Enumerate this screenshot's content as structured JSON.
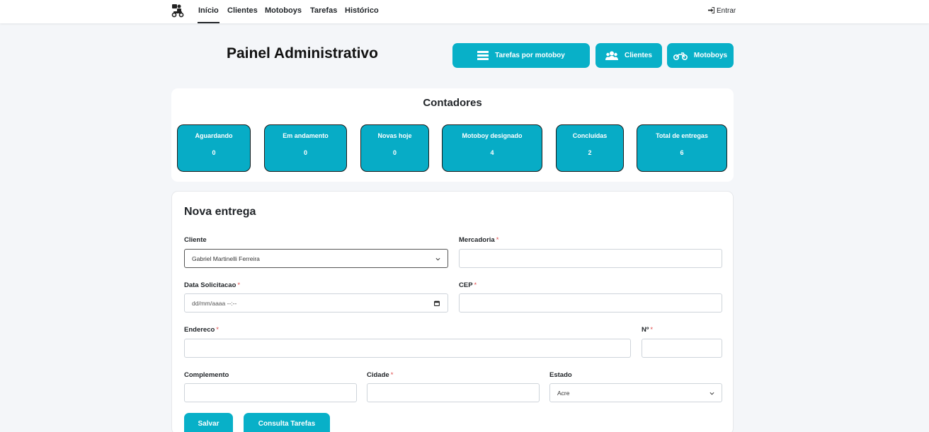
{
  "nav": {
    "brand_icon": "delivery-motoboy-logo-icon",
    "items": [
      {
        "label": "Início",
        "active": true
      },
      {
        "label": "Clientes",
        "active": false
      },
      {
        "label": "Motoboys",
        "active": false
      },
      {
        "label": "Tarefas",
        "active": false
      },
      {
        "label": "Histórico",
        "active": false
      }
    ],
    "login_icon": "sign-in-icon",
    "login_label": "Entrar"
  },
  "header": {
    "title": "Painel Administrativo",
    "buttons": [
      {
        "label": "Tarefas por motoboy",
        "icon": "list-icon"
      },
      {
        "label": "Clientes",
        "icon": "users-icon"
      },
      {
        "label": "Motoboys",
        "icon": "motorcycle-icon"
      }
    ]
  },
  "counters": {
    "title": "Contadores",
    "items": [
      {
        "label": "Aguardando",
        "value": "0"
      },
      {
        "label": "Em andamento",
        "value": "0"
      },
      {
        "label": "Novas hoje",
        "value": "0"
      },
      {
        "label": "Motoboy designado",
        "value": "4"
      },
      {
        "label": "Concluídas",
        "value": "2"
      },
      {
        "label": "Total de entregas",
        "value": "6"
      }
    ]
  },
  "form": {
    "title": "Nova entrega",
    "required_mark": "*",
    "cliente": {
      "label": "Cliente",
      "value": "Gabriel Martinelli Ferreira"
    },
    "mercadoria": {
      "label": "Mercadoria",
      "value": ""
    },
    "data_solicitacao": {
      "label": "Data Solicitacao",
      "value": "dd/mm/aaaa --:--"
    },
    "cep": {
      "label": "CEP",
      "value": ""
    },
    "endereco": {
      "label": "Endereco",
      "value": ""
    },
    "numero": {
      "label": "Nº",
      "value": ""
    },
    "complemento": {
      "label": "Complemento",
      "value": ""
    },
    "cidade": {
      "label": "Cidade",
      "value": ""
    },
    "estado": {
      "label": "Estado",
      "value": "Acre"
    },
    "save_label": "Salvar",
    "consult_label": "Consulta Tarefas"
  },
  "colors": {
    "accent": "#08b0c8",
    "background": "#f4f6f9",
    "required": "#e04b4b"
  }
}
